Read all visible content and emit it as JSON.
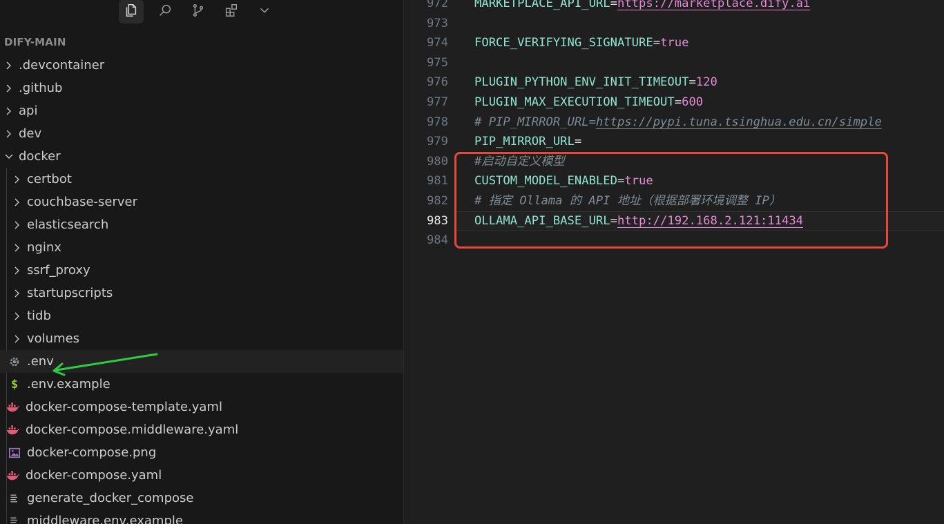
{
  "colors": {
    "sidebar_bg": "#181818",
    "editor_bg": "#1f1f1f",
    "highlight_box": "#e8483c",
    "arrow": "#2ecc40",
    "key": "#8fe3d0",
    "value": "#e48ad6",
    "comment": "#7f8a93"
  },
  "toolbar": {
    "icons": [
      "files-icon",
      "search-icon",
      "source-control-icon",
      "extensions-icon",
      "chevron-down-icon"
    ]
  },
  "explorer": {
    "title": "DIFY-MAIN",
    "items": [
      {
        "label": ".devcontainer",
        "type": "folder",
        "state": "collapsed",
        "depth": 0
      },
      {
        "label": ".github",
        "type": "folder",
        "state": "collapsed",
        "depth": 0
      },
      {
        "label": "api",
        "type": "folder",
        "state": "collapsed",
        "depth": 0
      },
      {
        "label": "dev",
        "type": "folder",
        "state": "collapsed",
        "depth": 0
      },
      {
        "label": "docker",
        "type": "folder",
        "state": "expanded",
        "depth": 0
      },
      {
        "label": "certbot",
        "type": "folder",
        "state": "collapsed",
        "depth": 1
      },
      {
        "label": "couchbase-server",
        "type": "folder",
        "state": "collapsed",
        "depth": 1
      },
      {
        "label": "elasticsearch",
        "type": "folder",
        "state": "collapsed",
        "depth": 1
      },
      {
        "label": "nginx",
        "type": "folder",
        "state": "collapsed",
        "depth": 1
      },
      {
        "label": "ssrf_proxy",
        "type": "folder",
        "state": "collapsed",
        "depth": 1
      },
      {
        "label": "startupscripts",
        "type": "folder",
        "state": "collapsed",
        "depth": 1
      },
      {
        "label": "tidb",
        "type": "folder",
        "state": "collapsed",
        "depth": 1
      },
      {
        "label": "volumes",
        "type": "folder",
        "state": "collapsed",
        "depth": 1
      },
      {
        "label": ".env",
        "type": "file",
        "icon": "gear-icon",
        "depth": 1,
        "selected": true
      },
      {
        "label": ".env.example",
        "type": "file",
        "icon": "dollar-icon",
        "depth": 1
      },
      {
        "label": "docker-compose-template.yaml",
        "type": "file",
        "icon": "docker-icon",
        "depth": 1
      },
      {
        "label": "docker-compose.middleware.yaml",
        "type": "file",
        "icon": "docker-icon",
        "depth": 1
      },
      {
        "label": "docker-compose.png",
        "type": "file",
        "icon": "image-icon",
        "depth": 1
      },
      {
        "label": "docker-compose.yaml",
        "type": "file",
        "icon": "docker-icon",
        "depth": 1
      },
      {
        "label": "generate_docker_compose",
        "type": "file",
        "icon": "lines-icon",
        "depth": 1
      },
      {
        "label": "middleware.env.example",
        "type": "file",
        "icon": "lines-icon",
        "depth": 1
      }
    ]
  },
  "editor": {
    "current_line": 983,
    "lines": [
      {
        "num": "972",
        "tokens": [
          {
            "t": "MARKETPLACE_API_URL",
            "c": "key"
          },
          {
            "t": "=",
            "c": "op"
          },
          {
            "t": "https://marketplace.dify.ai",
            "c": "url"
          }
        ]
      },
      {
        "num": "973",
        "tokens": []
      },
      {
        "num": "974",
        "tokens": [
          {
            "t": "FORCE_VERIFYING_SIGNATURE",
            "c": "key"
          },
          {
            "t": "=",
            "c": "op"
          },
          {
            "t": "true",
            "c": "bool"
          }
        ]
      },
      {
        "num": "975",
        "tokens": []
      },
      {
        "num": "976",
        "tokens": [
          {
            "t": "PLUGIN_PYTHON_ENV_INIT_TIMEOUT",
            "c": "key"
          },
          {
            "t": "=",
            "c": "op"
          },
          {
            "t": "120",
            "c": "num"
          }
        ]
      },
      {
        "num": "977",
        "tokens": [
          {
            "t": "PLUGIN_MAX_EXECUTION_TIMEOUT",
            "c": "key"
          },
          {
            "t": "=",
            "c": "op"
          },
          {
            "t": "600",
            "c": "num"
          }
        ]
      },
      {
        "num": "978",
        "tokens": [
          {
            "t": "# PIP_MIRROR_URL=",
            "c": "cmt"
          },
          {
            "t": "https://pypi.tuna.tsinghua.edu.cn/simple",
            "c": "cmt-url"
          }
        ]
      },
      {
        "num": "979",
        "tokens": [
          {
            "t": "PIP_MIRROR_URL",
            "c": "key"
          },
          {
            "t": "=",
            "c": "op"
          }
        ]
      },
      {
        "num": "980",
        "tokens": [
          {
            "t": "#启动自定义模型",
            "c": "cmt"
          }
        ]
      },
      {
        "num": "981",
        "tokens": [
          {
            "t": "CUSTOM_MODEL_ENABLED",
            "c": "key"
          },
          {
            "t": "=",
            "c": "op"
          },
          {
            "t": "true",
            "c": "bool"
          }
        ]
      },
      {
        "num": "982",
        "tokens": [
          {
            "t": "# 指定 Ollama 的 API 地址（根据部署环境调整 IP）",
            "c": "cmt"
          }
        ]
      },
      {
        "num": "983",
        "tokens": [
          {
            "t": "OLLAMA_API_BASE_URL",
            "c": "key"
          },
          {
            "t": "=",
            "c": "op"
          },
          {
            "t": "http://192.168.2.121:11434",
            "c": "url"
          }
        ]
      },
      {
        "num": "984",
        "tokens": []
      }
    ]
  }
}
